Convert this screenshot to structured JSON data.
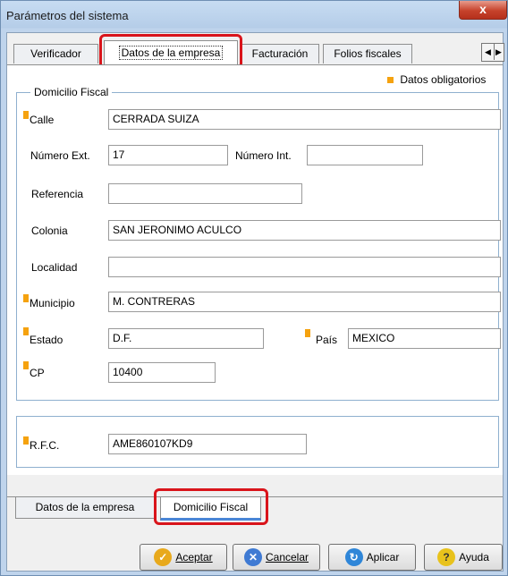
{
  "window": {
    "title": "Parámetros del sistema",
    "close_glyph": "x"
  },
  "top_tabs": [
    {
      "label": "Verificador"
    },
    {
      "label": "Datos de la empresa"
    },
    {
      "label": "Facturación"
    },
    {
      "label": "Folios fiscales"
    }
  ],
  "tab_scroll": {
    "left_glyph": "◀",
    "right_glyph": "▶"
  },
  "legend": {
    "text": "Datos obligatorios"
  },
  "group1": {
    "caption": "Domicilio Fiscal"
  },
  "fields": {
    "calle": {
      "label": "Calle",
      "value": "CERRADA SUIZA"
    },
    "numero_ext": {
      "label": "Número Ext.",
      "value": "17"
    },
    "numero_int": {
      "label": "Número Int.",
      "value": ""
    },
    "referencia": {
      "label": "Referencia",
      "value": ""
    },
    "colonia": {
      "label": "Colonia",
      "value": "SAN JERONIMO ACULCO"
    },
    "localidad": {
      "label": "Localidad",
      "value": ""
    },
    "municipio": {
      "label": "Municipio",
      "value": "M. CONTRERAS"
    },
    "estado": {
      "label": "Estado",
      "value": "D.F."
    },
    "pais": {
      "label": "País",
      "value": "MEXICO"
    },
    "cp": {
      "label": "CP",
      "value": "10400"
    },
    "rfc": {
      "label": "R.F.C.",
      "value": "AME860107KD9"
    }
  },
  "bottom_tabs": [
    {
      "label": "Datos de la empresa"
    },
    {
      "label": "Domicilio Fiscal"
    }
  ],
  "buttons": {
    "aceptar": "Aceptar",
    "cancelar": "Cancelar",
    "aplicar": "Aplicar",
    "ayuda": "Ayuda"
  },
  "colors": {
    "required_marker": "#f5a20f",
    "highlight": "#d9141b"
  }
}
